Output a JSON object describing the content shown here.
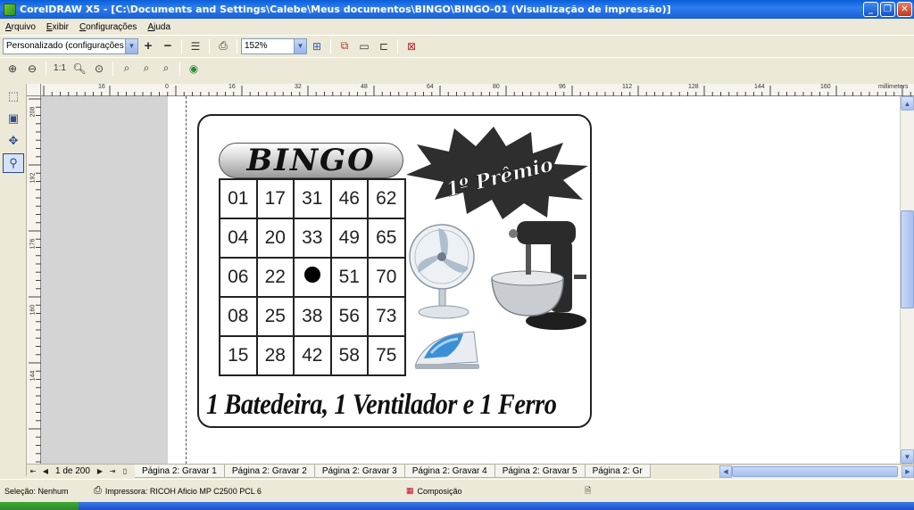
{
  "window": {
    "title": "CorelDRAW X5 - [C:\\Documents and Settings\\Calebe\\Meus documentos\\BINGO\\BINGO-01 (Visualização de impressão)]",
    "controls": [
      "minimize-icon",
      "restore-icon",
      "close-icon"
    ]
  },
  "menu": [
    "Arquivo",
    "Exibir",
    "Configurações",
    "Ajuda"
  ],
  "toolbar": {
    "preset": "Personalizado (configurações a...",
    "zoom": "152%"
  },
  "rulers": {
    "unit": "millimeters",
    "h_ticks": [
      "16",
      "0",
      "16",
      "32",
      "48",
      "64",
      "80",
      "96",
      "112",
      "128",
      "144",
      "160"
    ],
    "v_ticks": [
      "208",
      "192",
      "176",
      "160",
      "144"
    ]
  },
  "card": {
    "title": "BINGO",
    "prize_badge": "1º Prêmio",
    "grid": [
      [
        "01",
        "17",
        "31",
        "46",
        "62"
      ],
      [
        "04",
        "20",
        "33",
        "49",
        "65"
      ],
      [
        "06",
        "22",
        "",
        "51",
        "70"
      ],
      [
        "08",
        "25",
        "38",
        "56",
        "73"
      ],
      [
        "15",
        "28",
        "42",
        "58",
        "75"
      ]
    ],
    "prize_text": "1 Batedeira, 1 Ventilador e 1 Ferro"
  },
  "pagebar": {
    "counter": "1 de 200",
    "tabs": [
      "Página 2: Gravar 1",
      "Página 2: Gravar 2",
      "Página 2: Gravar 3",
      "Página 2: Gravar 4",
      "Página 2: Gravar 5",
      "Página 2: Gr"
    ]
  },
  "status": {
    "selection": "Seleção: Nenhum",
    "printer": "Impressora: RICOH Aficio MP C2500 PCL 6",
    "mode": "Composição"
  },
  "colors": {
    "title_bar": "#1a5fd0",
    "chrome": "#ece9d8",
    "desk": "#d4d4d4"
  }
}
